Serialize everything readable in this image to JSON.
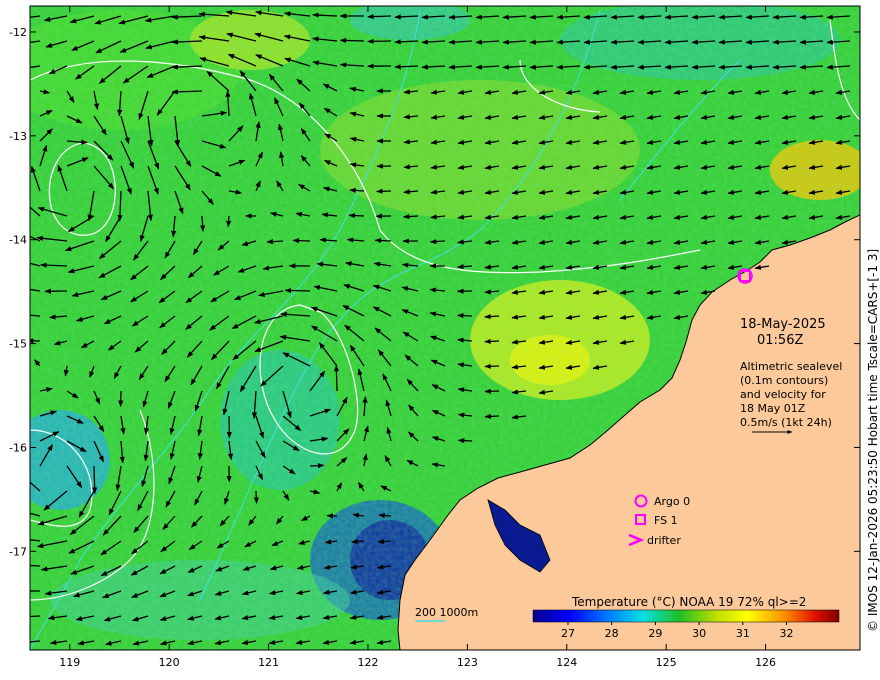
{
  "map": {
    "lon_ticks": [
      "119",
      "120",
      "121",
      "122",
      "123",
      "124",
      "125",
      "126"
    ],
    "lat_ticks": [
      "-12",
      "-13",
      "-14",
      "-15",
      "-16",
      "-17"
    ],
    "lon_range": [
      118.6,
      126.95
    ],
    "lat_range": [
      -17.95,
      -11.75
    ]
  },
  "annotation": {
    "date": "18-May-2025",
    "time": "01:56Z",
    "desc_lines": [
      "Altimetric sealevel",
      "(0.1m contours)",
      "and velocity for",
      "18 May 01Z",
      "0.5m/s (1kt 24h)"
    ]
  },
  "legend": {
    "items": [
      {
        "label": "Argo 0",
        "symbol": "circle-icon"
      },
      {
        "label": "FS 1",
        "symbol": "square-icon"
      },
      {
        "label": "drifter",
        "symbol": "chevron-icon"
      }
    ],
    "symbol_color": "#ff00ff"
  },
  "isobath": {
    "label": "200  1000m",
    "color": "#40e0e0"
  },
  "colorbar": {
    "title": "Temperature (°C) NOAA 19 72% ql>=2",
    "ticks": [
      "27",
      "28",
      "29",
      "30",
      "31",
      "32"
    ],
    "range": [
      26.2,
      33.2
    ]
  },
  "credit": "© IMOS 12-Jan-2026 05:23:50 Hobart time Tscale=CARS+[-1 3]",
  "colors": {
    "land": "#fbc99a",
    "arrow": "#000000",
    "contour": "#ffffff"
  }
}
